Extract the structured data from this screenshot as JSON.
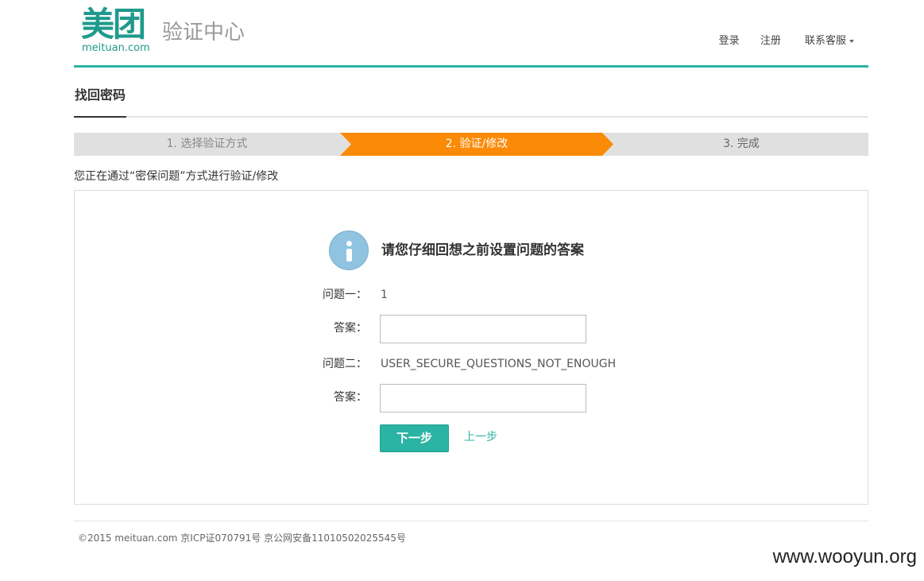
{
  "header": {
    "logo_cn": "美团",
    "logo_domain": "meituan.com",
    "site_title": "验证中心",
    "nav": {
      "login": "登录",
      "register": "注册",
      "customer_service": "联系客服"
    }
  },
  "page": {
    "title": "找回密码"
  },
  "steps": [
    {
      "label": "1. 选择验证方式",
      "state": "done"
    },
    {
      "label": "2. 验证/修改",
      "state": "active"
    },
    {
      "label": "3. 完成",
      "state": "pending"
    }
  ],
  "description": "您正在通过“密保问题”方式进行验证/修改",
  "form": {
    "prompt": "请您仔细回想之前设置问题的答案",
    "question1_label": "问题一：",
    "question1_value": "1",
    "answer1_label": "答案：",
    "answer1_value": "",
    "question2_label": "问题二：",
    "question2_value": "USER_SECURE_QUESTIONS_NOT_ENOUGH",
    "answer2_label": "答案：",
    "answer2_value": "",
    "next_button": "下一步",
    "prev_link": "上一步"
  },
  "footer": {
    "copyright": "©2015 meituan.com 京ICP证070791号 京公网安备11010502025545号"
  },
  "watermark": "www.wooyun.org",
  "colors": {
    "brand": "#2bb3a3",
    "active_step": "#fb8a07",
    "info_icon": "#8fc3df"
  },
  "icons": {
    "info": "info-icon",
    "dropdown": "caret-down-icon"
  }
}
